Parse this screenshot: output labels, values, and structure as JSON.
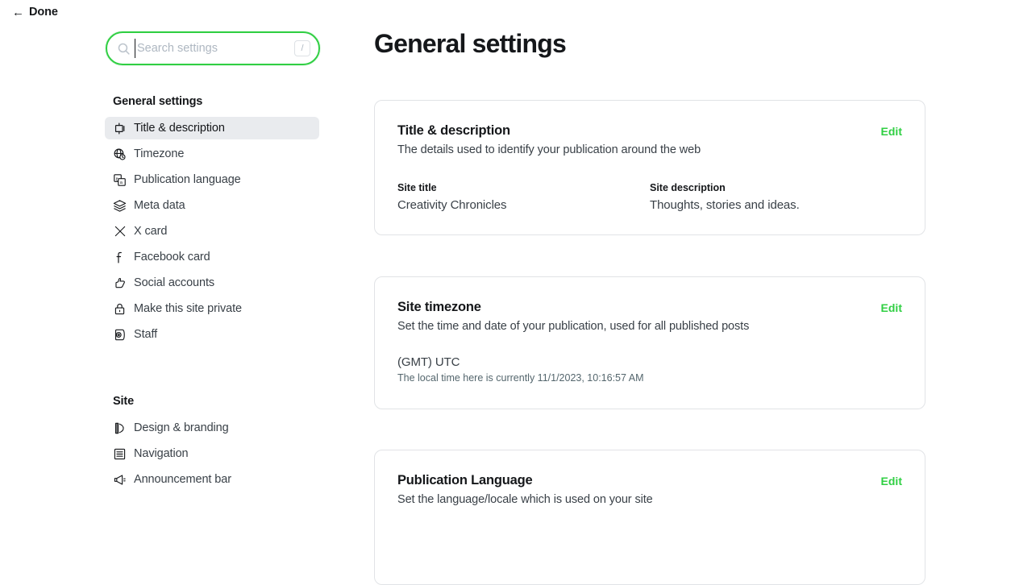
{
  "topbar": {
    "back_label": "Done",
    "back_icon": "arrow-left-icon",
    "arrow_glyph": "←"
  },
  "search": {
    "placeholder": "Search settings",
    "value": "",
    "icon": "search-icon",
    "shortcut_key": "/"
  },
  "sidebar": {
    "groups": [
      {
        "title": "General settings",
        "items": [
          {
            "label": "Title & description",
            "icon": "title-description-icon",
            "selected": true
          },
          {
            "label": "Timezone",
            "icon": "globe-clock-icon",
            "selected": false
          },
          {
            "label": "Publication language",
            "icon": "translate-icon",
            "selected": false
          },
          {
            "label": "Meta data",
            "icon": "layers-icon",
            "selected": false
          },
          {
            "label": "X card",
            "icon": "x-logo-icon",
            "selected": false
          },
          {
            "label": "Facebook card",
            "icon": "facebook-logo-icon",
            "selected": false
          },
          {
            "label": "Social accounts",
            "icon": "thumbs-up-icon",
            "selected": false
          },
          {
            "label": "Make this site private",
            "icon": "lock-icon",
            "selected": false
          },
          {
            "label": "Staff",
            "icon": "staff-badge-icon",
            "selected": false
          }
        ]
      },
      {
        "title": "Site",
        "items": [
          {
            "label": "Design & branding",
            "icon": "paintbrush-icon",
            "selected": false
          },
          {
            "label": "Navigation",
            "icon": "list-menu-icon",
            "selected": false
          },
          {
            "label": "Announcement bar",
            "icon": "megaphone-icon",
            "selected": false
          }
        ]
      }
    ]
  },
  "main": {
    "page_title": "General settings",
    "cards": [
      {
        "title": "Title & description",
        "subtitle": "The details used to identify your publication around the web",
        "edit_label": "Edit",
        "fields": [
          {
            "label": "Site title",
            "value": "Creativity Chronicles"
          },
          {
            "label": "Site description",
            "value": "Thoughts, stories and ideas."
          }
        ]
      },
      {
        "title": "Site timezone",
        "subtitle": "Set the time and date of your publication, used for all published posts",
        "edit_label": "Edit",
        "timezone_value": "(GMT) UTC",
        "local_time_note": "The local time here is currently 11/1/2023, 10:16:57 AM"
      },
      {
        "title": "Publication Language",
        "subtitle": "Set the language/locale which is used on your site",
        "edit_label": "Edit"
      }
    ]
  },
  "colors": {
    "accent_green": "#30cf43",
    "text_primary": "#15171a",
    "text_secondary": "#394047",
    "selected_row_bg": "#e9ebee",
    "card_border": "#e1e3e6"
  }
}
